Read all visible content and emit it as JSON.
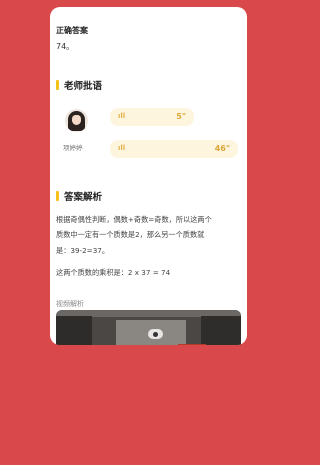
{
  "answer_section": {
    "label": "正确答案",
    "value": "74。"
  },
  "teacher_comment": {
    "title": "老师批语",
    "teacher_name": "项婷婷",
    "voices": [
      {
        "wave_icon": "sound-wave-icon",
        "duration": "5\""
      },
      {
        "wave_icon": "sound-wave-icon",
        "duration": "46\""
      }
    ]
  },
  "analysis": {
    "title": "答案解析",
    "lines": [
      "根据奇偶性判断，偶数+奇数=奇数，所以这两个",
      "质数中一定有一个质数是2，那么另一个质数就",
      "是：39-2=37。",
      "这两个质数的乘积是：2 x 37 = 74"
    ],
    "video_label": "视频解析"
  },
  "colors": {
    "background": "#d9494c",
    "accent": "#f5c21b",
    "voice_bubble": "#fef5df"
  }
}
